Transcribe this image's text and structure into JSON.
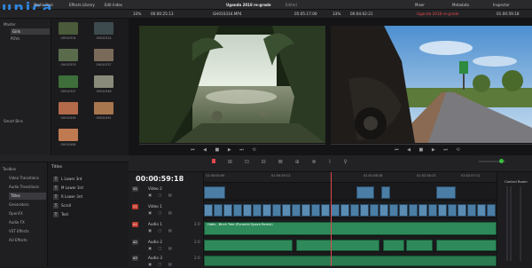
{
  "app": {
    "logo": "unica",
    "toolbar_left": [
      "Media Pool",
      "Effects Library",
      "Edit Index"
    ],
    "project_title": "Uganda 2018 re-grade",
    "project_status": "Edited",
    "toolbar_right": [
      "Mixer",
      "Metadata",
      "Inspector"
    ]
  },
  "source_bar": {
    "zoom": "33%",
    "source_tc": "00:00:25:13",
    "clip_name": "GH010334.MP4",
    "clip_tc": "05:05:17:00",
    "timeline_zoom": "33%",
    "timeline_tc": "00:04:02:21",
    "timeline_name": "Uganda 2018 re-grade",
    "timeline_tc2": "01:00:59:18"
  },
  "media_pool": {
    "bins": [
      "Master",
      "Girls",
      "POVs"
    ],
    "smart_bins_label": "Smart Bins",
    "clips": [
      {
        "label": "GH010334",
        "color": "#4a5a3a"
      },
      {
        "label": "GH010324",
        "color": "#3d4a4e"
      },
      {
        "label": "GH010333",
        "color": "#5a6b4c"
      },
      {
        "label": "GH010337",
        "color": "#7a6a5a"
      },
      {
        "label": "GH010347",
        "color": "#3e6e3a"
      },
      {
        "label": "GH010348",
        "color": "#8a8a7a"
      },
      {
        "label": "GH010490",
        "color": "#b26a4a"
      },
      {
        "label": "GH010491",
        "color": "#a8764e"
      },
      {
        "label": "GH010484",
        "color": "#c07a52"
      }
    ]
  },
  "effects": {
    "panel_label": "Toolbox",
    "categories": [
      "Toolbox",
      "Video Transitions",
      "Audio Transitions",
      "Titles",
      "Generators",
      "OpenFX",
      "Audio FX",
      "VST Effects",
      "AU Effects"
    ],
    "active_category": "Titles",
    "list_header": "Titles",
    "titles": [
      "L Lower 3rd",
      "M Lower 3rd",
      "R Lower 3rd",
      "Scroll",
      "Text"
    ]
  },
  "timeline": {
    "timecode": "00:00:59:18",
    "ruler": [
      "01:00:00:00",
      "01:00:29:12",
      "01:01:58:18",
      "01:02:28:13",
      "01:02:57:11"
    ],
    "tracks": [
      {
        "id": "V2",
        "name": "Video 2",
        "kind": "video"
      },
      {
        "id": "V1",
        "name": "Video 1",
        "kind": "video"
      },
      {
        "id": "A1",
        "name": "Audio 1",
        "kind": "audio",
        "channels": "2.0"
      },
      {
        "id": "A2",
        "name": "Audio 2",
        "kind": "audio",
        "channels": "2.0"
      },
      {
        "id": "A3",
        "name": "Audio 3",
        "kind": "audio",
        "channels": "2.0"
      }
    ],
    "audio_clip_name": "Hatis - Birch Tree (Pyramid Space Remix)",
    "mixer_label": "Control Room"
  },
  "colors": {
    "accent_red": "#e0474b",
    "accent_blue": "#2f86e0",
    "video_clip": "#4b7ea5",
    "audio_clip": "#2e8a5a"
  }
}
